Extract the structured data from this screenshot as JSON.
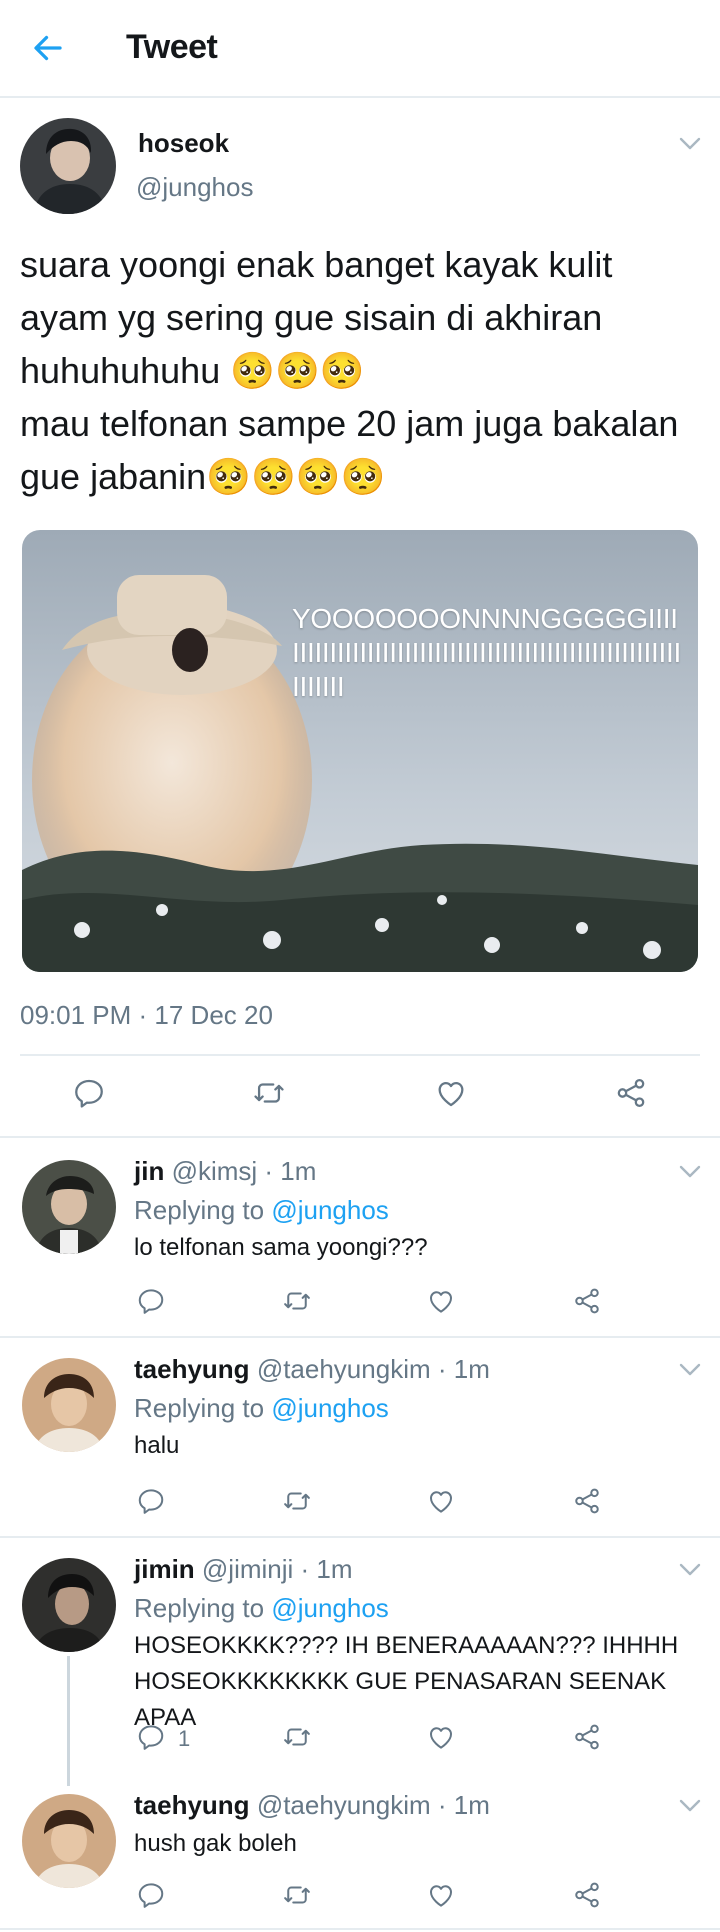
{
  "header": {
    "title": "Tweet",
    "back_icon": "arrow-left-icon"
  },
  "main_tweet": {
    "name": "hoseok",
    "handle": "@junghos",
    "text": "suara yoongi enak banget kayak kulit ayam yg sering gue sisain di akhiran huhuhuhuhu 🥺🥺🥺\nmau telfonan sampe 20 jam juga bakalan gue jabanin🥺🥺🥺🥺",
    "media_caption": "YOOOOOOONNNNGGGGGIIIIIIIIIIIIIIIIIIIIIIIIIIIIIIIIIIIIIIIIIIIIIIIIIIIIIIIIIIIIIII",
    "timestamp": "09:01 PM · 17 Dec 20"
  },
  "replies": [
    {
      "name": "jin",
      "meta": "@kimsj · 1m",
      "replying_label": "Replying to",
      "replying_to": "@junghos",
      "text": "lo telfonan sama yoongi???"
    },
    {
      "name": "taehyung",
      "meta": "@taehyungkim · 1m",
      "replying_label": "Replying to",
      "replying_to": "@junghos",
      "text": "halu"
    },
    {
      "name": "jimin",
      "meta": "@jiminji · 1m",
      "replying_label": "Replying to",
      "replying_to": "@junghos",
      "text": "HOSEOKKKK???? IH BENERAAAAAN??? IHHHH HOSEOKKKKKKKK GUE PENASARAN SEENAK APAA",
      "reply_count": "1"
    },
    {
      "name": "taehyung",
      "meta": "@taehyungkim · 1m",
      "text": "hush gak boleh"
    }
  ],
  "colors": {
    "accent": "#1da1f2",
    "secondary_text": "#657786",
    "divider": "#e6ecf0",
    "icon": "#657786"
  }
}
